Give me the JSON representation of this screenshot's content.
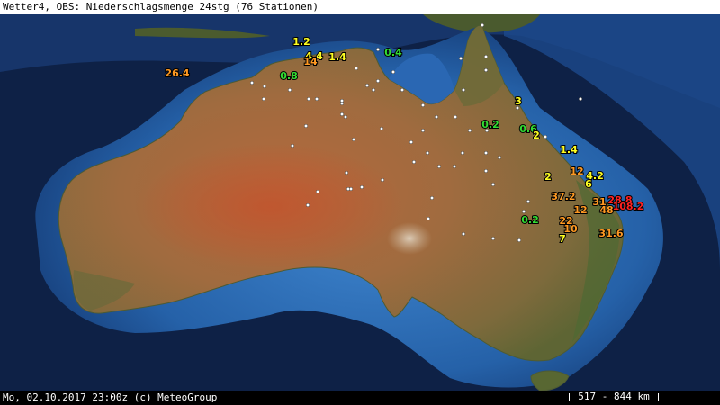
{
  "header": {
    "title": "Wetter4, OBS: Niederschlagsmenge 24stg (76 Stationen)"
  },
  "footer": {
    "credit": "Mo, 02.10.2017 23:00z (c) MeteoGroup",
    "scale": "517 - 844 km"
  },
  "colors": {
    "ocean_deep": "#0b1c3a",
    "ocean_shelf": "#2a6ab3",
    "land": "#9c6a3e",
    "green": "#33dd33",
    "yellow": "#ffff22",
    "orange": "#ff9922",
    "red": "#ff2222"
  },
  "stations": [
    {
      "value": "26.4",
      "color": "orange"
    },
    {
      "value": "1.2",
      "color": "yellow"
    },
    {
      "value": "4.4",
      "color": "yellow"
    },
    {
      "value": "14",
      "color": "orange"
    },
    {
      "value": "1.4",
      "color": "yellow"
    },
    {
      "value": "0.4",
      "color": "green"
    },
    {
      "value": "0.8",
      "color": "green"
    },
    {
      "value": "3",
      "color": "yellow"
    },
    {
      "value": "0.2",
      "color": "green"
    },
    {
      "value": "0.6",
      "color": "green"
    },
    {
      "value": "2",
      "color": "yellow"
    },
    {
      "value": "1.4",
      "color": "yellow"
    },
    {
      "value": "12",
      "color": "orange"
    },
    {
      "value": "4.2",
      "color": "yellow"
    },
    {
      "value": "2",
      "color": "yellow"
    },
    {
      "value": "6",
      "color": "yellow"
    },
    {
      "value": "37.2",
      "color": "orange"
    },
    {
      "value": "31",
      "color": "orange"
    },
    {
      "value": "28.8",
      "color": "red"
    },
    {
      "value": "12",
      "color": "orange"
    },
    {
      "value": "48",
      "color": "orange"
    },
    {
      "value": "108.2",
      "color": "red"
    },
    {
      "value": "0.2",
      "color": "green"
    },
    {
      "value": "22",
      "color": "orange"
    },
    {
      "value": "10",
      "color": "orange"
    },
    {
      "value": "31.6",
      "color": "orange"
    },
    {
      "value": "7",
      "color": "yellow"
    }
  ]
}
